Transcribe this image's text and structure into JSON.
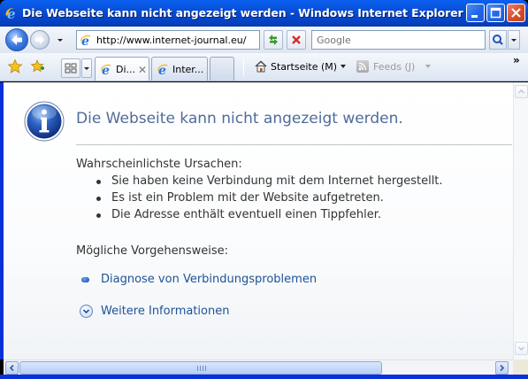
{
  "window": {
    "title": "Die Webseite kann nicht angezeigt werden - Windows Internet Explorer"
  },
  "navigation": {
    "address_value": "http://www.internet-journal.eu/",
    "search_placeholder": "Google"
  },
  "tabs": [
    {
      "label": "Di...",
      "active": true
    },
    {
      "label": "Inter...",
      "active": false
    }
  ],
  "command_bar": {
    "home_label": "Startseite (M)",
    "feeds_label": "Feeds (J)",
    "more": "»"
  },
  "page": {
    "title": "Die Webseite kann nicht angezeigt werden.",
    "causes_heading": "Wahrscheinlichste Ursachen:",
    "causes": [
      "Sie haben keine Verbindung mit dem Internet hergestellt.",
      "Es ist ein Problem mit der Website aufgetreten.",
      "Die Adresse enthält eventuell einen Tippfehler."
    ],
    "actions_heading": "Mögliche Vorgehensweise:",
    "diagnose_link": "Diagnose von Verbindungsproblemen",
    "more_info_link": "Weitere Informationen"
  },
  "colors": {
    "titlebar": "#0649d4",
    "link": "#1f5297",
    "page_title": "#4e6c9a"
  }
}
